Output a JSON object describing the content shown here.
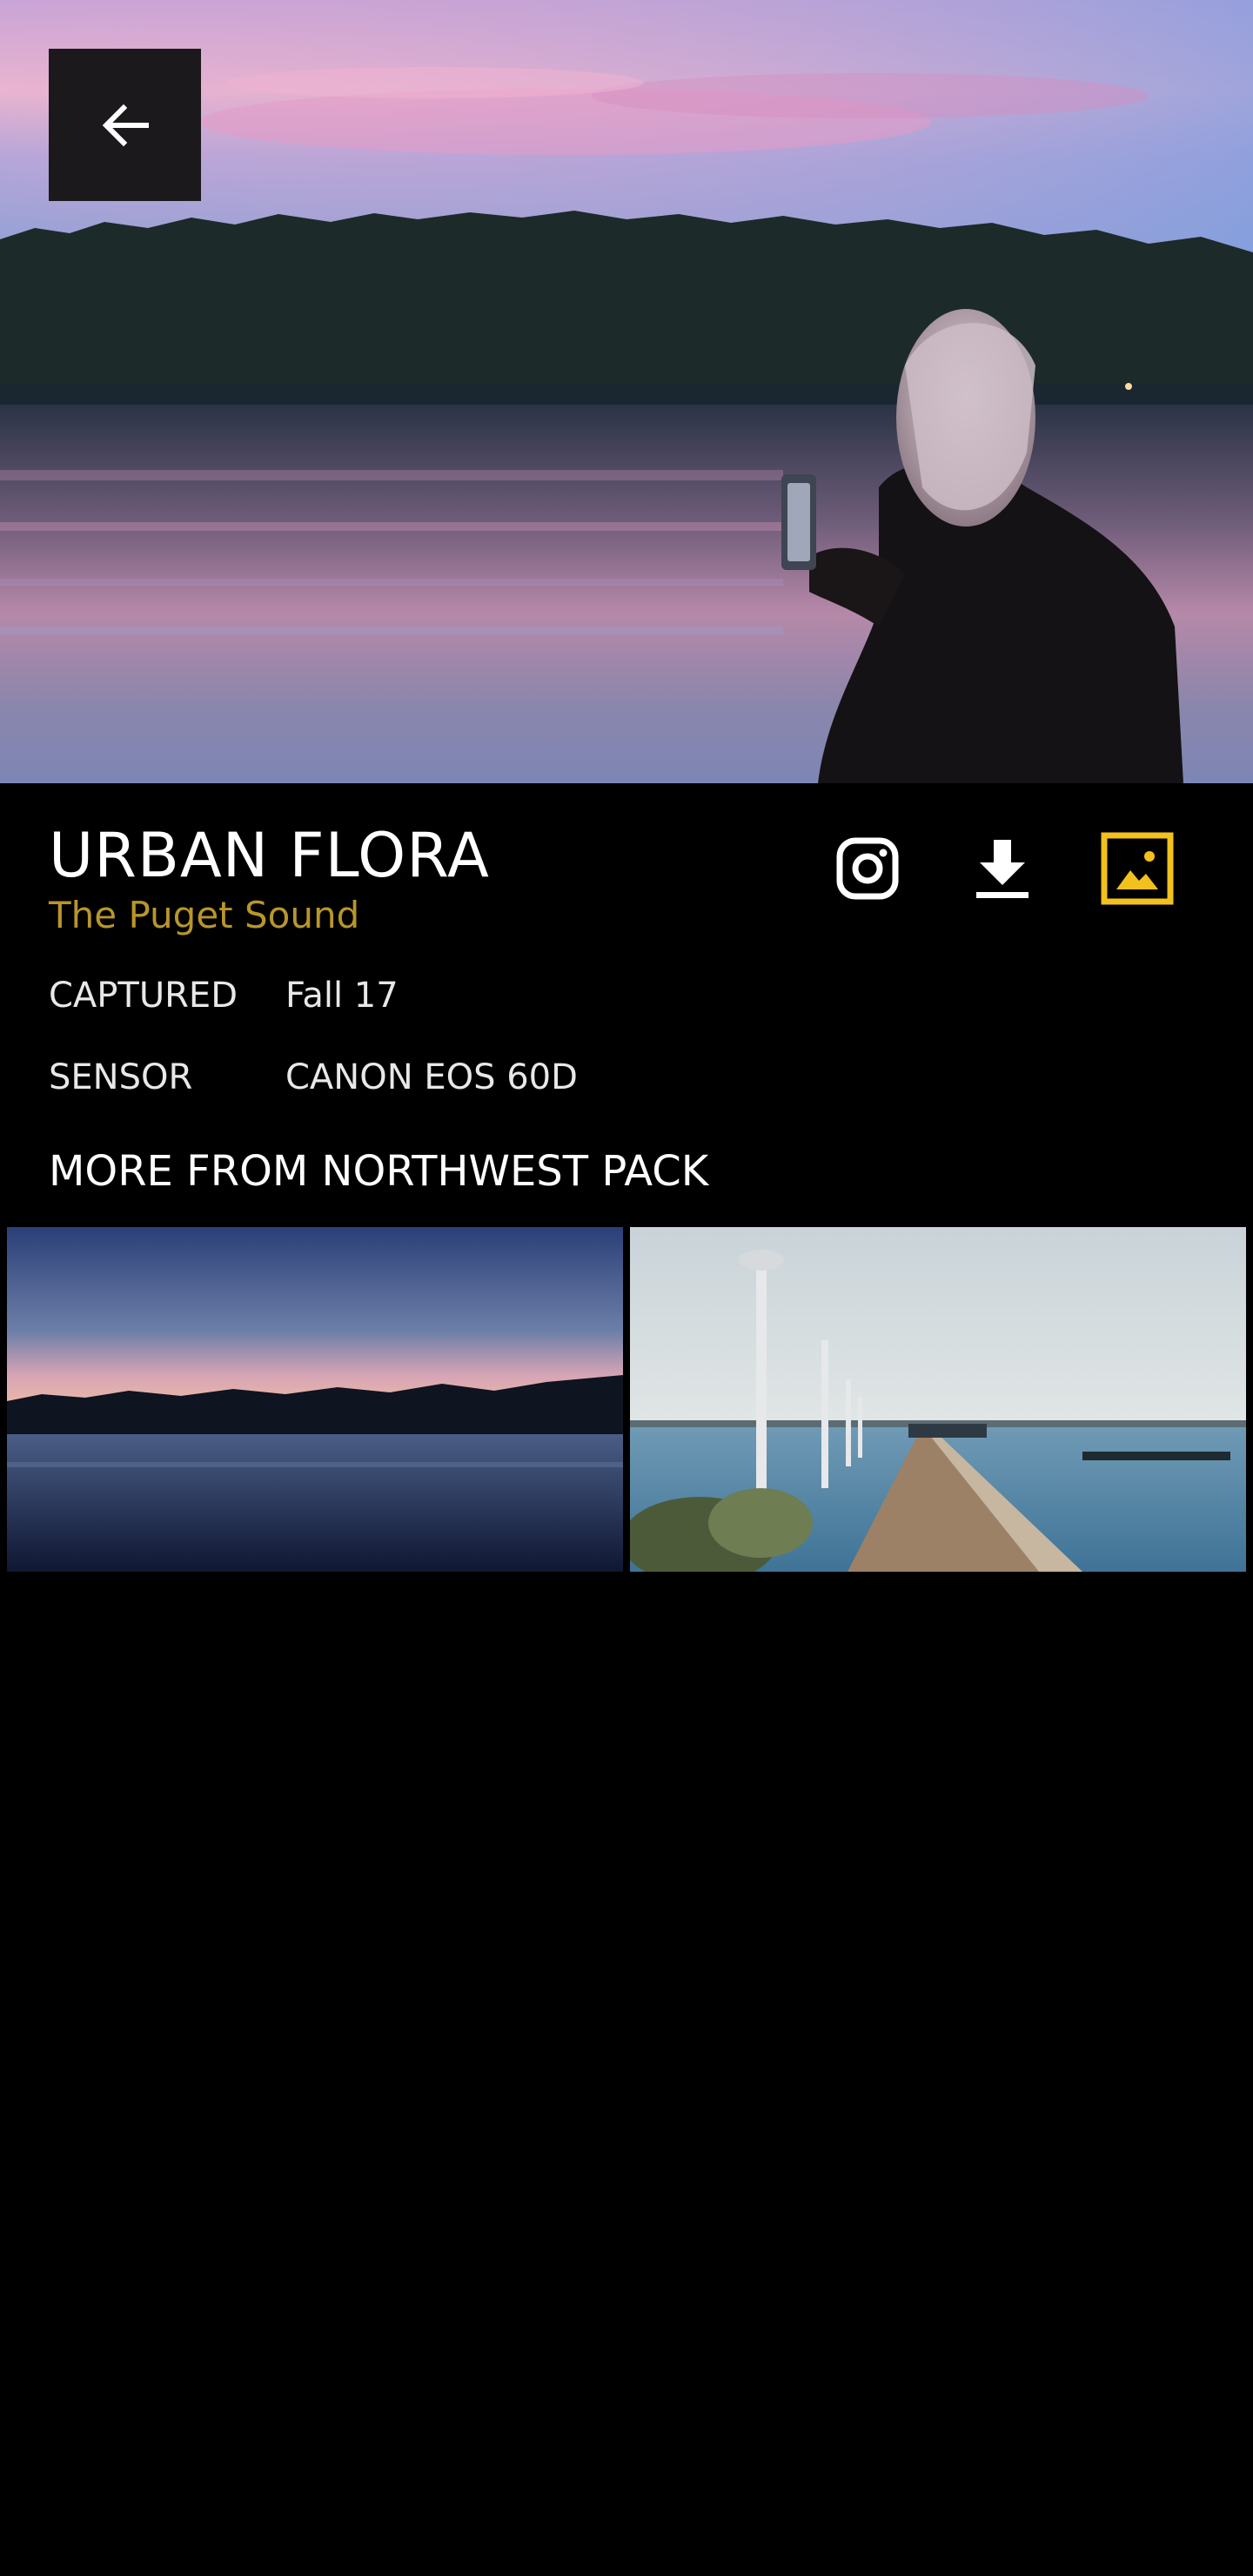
{
  "photo": {
    "title": "URBAN FLORA",
    "location": "The Puget Sound"
  },
  "meta": [
    {
      "label": "CAPTURED",
      "value": "Fall 17"
    },
    {
      "label": "SENSOR",
      "value": "CANON EOS 60D"
    }
  ],
  "more_section": {
    "title": "MORE FROM NORTHWEST PACK"
  },
  "icons": {
    "back": "arrow-left-icon",
    "instagram": "instagram-icon",
    "download": "download-icon",
    "wallpaper": "set-wallpaper-icon"
  },
  "colors": {
    "background": "#000000",
    "accent": "#f2c11d",
    "subtitle": "#b8962b",
    "back_button": "#1b191c"
  }
}
